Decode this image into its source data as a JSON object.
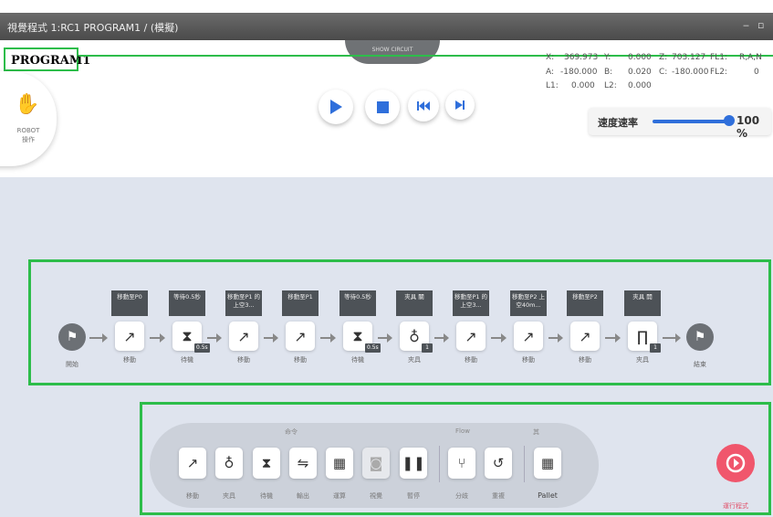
{
  "window": {
    "title": "視覺程式 1:RC1 PROGRAM1 / (模擬)",
    "controls": [
      "‒",
      "▫"
    ]
  },
  "program_name": "PROGRAM1",
  "top_tab": "SHOW CIRCUIT",
  "robot_button": {
    "label_line1": "ROBOT",
    "label_line2": "操作"
  },
  "playback": {
    "play": "play-icon",
    "stop": "stop-icon",
    "skip_back": "skip-back-icon",
    "step": "step-forward-icon"
  },
  "coords": [
    [
      {
        "k": "X:",
        "v": "369.973"
      },
      {
        "k": "Y:",
        "v": "0.000"
      },
      {
        "k": "Z:",
        "v": "703.127"
      },
      {
        "k": "FL1:",
        "v": "R,A,N"
      }
    ],
    [
      {
        "k": "A:",
        "v": "-180.000"
      },
      {
        "k": "B:",
        "v": "0.020"
      },
      {
        "k": "C:",
        "v": "-180.000"
      },
      {
        "k": "FL2:",
        "v": "0"
      }
    ],
    [
      {
        "k": "L1:",
        "v": "0.000"
      },
      {
        "k": "L2:",
        "v": "0.000"
      }
    ]
  ],
  "speed": {
    "label": "速度速率",
    "value": "100 %",
    "level_pct": 100,
    "accent": "#2f6fdb"
  },
  "flow": {
    "start": "開始",
    "end": "結束",
    "nodes": [
      {
        "top": "移動至P0",
        "icon": "move-icon",
        "glyph": "↗",
        "sub": "移動",
        "badge": ""
      },
      {
        "top": "等待0.5秒",
        "icon": "hourglass-icon",
        "glyph": "⧗",
        "sub": "待機",
        "badge": "0.5s"
      },
      {
        "top": "移動至P1 的上空3...",
        "icon": "move-icon",
        "glyph": "↗",
        "sub": "移動",
        "badge": ""
      },
      {
        "top": "移動至P1",
        "icon": "move-icon",
        "glyph": "↗",
        "sub": "移動",
        "badge": ""
      },
      {
        "top": "等待0.5秒",
        "icon": "hourglass-icon",
        "glyph": "⧗",
        "sub": "待機",
        "badge": "0.5s"
      },
      {
        "top": "夾具 關",
        "icon": "gripper-close-icon",
        "glyph": "♁",
        "sub": "夾具",
        "badge": "1"
      },
      {
        "top": "移動至P1 的上空3...",
        "icon": "move-icon",
        "glyph": "↗",
        "sub": "移動",
        "badge": ""
      },
      {
        "top": "移動至P2 上空40m...",
        "icon": "move-icon",
        "glyph": "↗",
        "sub": "移動",
        "badge": ""
      },
      {
        "top": "移動至P2",
        "icon": "move-icon",
        "glyph": "↗",
        "sub": "移動",
        "badge": ""
      },
      {
        "top": "夾具 開",
        "icon": "gripper-open-icon",
        "glyph": "∏",
        "sub": "夾具",
        "badge": "1"
      }
    ]
  },
  "palette": {
    "groups": [
      "命令",
      "Flow",
      "其"
    ],
    "items": [
      {
        "label": "移動",
        "icon": "move-icon",
        "glyph": "↗",
        "disabled": false
      },
      {
        "label": "夾具",
        "icon": "gripper-icon",
        "glyph": "♁",
        "disabled": false
      },
      {
        "label": "待機",
        "icon": "hourglass-icon",
        "glyph": "⧗",
        "disabled": false
      },
      {
        "label": "輸出",
        "icon": "output-icon",
        "glyph": "⇋",
        "disabled": false
      },
      {
        "label": "運算",
        "icon": "calculator-icon",
        "glyph": "▦",
        "disabled": false
      },
      {
        "label": "視覺",
        "icon": "camera-icon",
        "glyph": "◙",
        "disabled": true
      },
      {
        "label": "暫停",
        "icon": "pause-icon",
        "glyph": "❚❚",
        "disabled": false
      },
      {
        "label": "分歧",
        "icon": "branch-icon",
        "glyph": "⑂",
        "disabled": false
      },
      {
        "label": "重複",
        "icon": "loop-icon",
        "glyph": "↺",
        "disabled": false
      },
      {
        "label": "Pallet",
        "icon": "pallet-icon",
        "glyph": "▦",
        "disabled": false
      }
    ]
  },
  "run_button": {
    "label": "運行程式",
    "color": "#f0566c"
  }
}
